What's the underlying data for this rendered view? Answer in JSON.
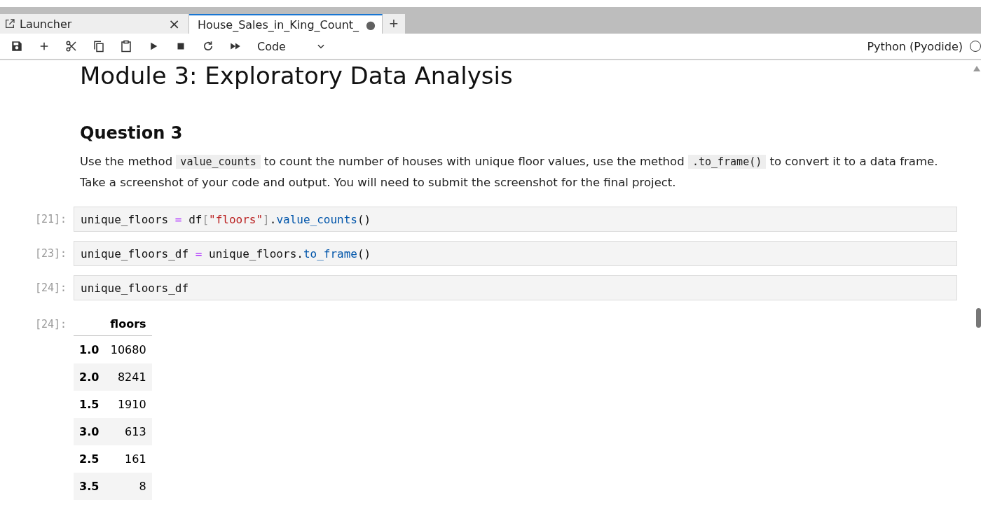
{
  "tabs": [
    {
      "label": "Launcher",
      "kind": "launcher",
      "selected": false,
      "close": "×"
    },
    {
      "label": "House_Sales_in_King_Count_",
      "kind": "notebook",
      "selected": true,
      "close": "●"
    }
  ],
  "new_tab": "+",
  "toolbar": {
    "cell_type": "Code",
    "kernel": "Python (Pyodide)",
    "kernel_busy": false
  },
  "markdown": {
    "h1": "Module 3: Exploratory Data Analysis",
    "h2": "Question 3",
    "paragraph": [
      {
        "text": "Use the method ",
        "kind": "text"
      },
      {
        "text": "value_counts",
        "kind": "code"
      },
      {
        "text": " to count the number of houses with unique floor values, use the method ",
        "kind": "text"
      },
      {
        "text": ".to_frame()",
        "kind": "code"
      },
      {
        "text": " to convert it to a data frame. Take a screenshot of your code and output. You will need to submit the screenshot for the final project.",
        "kind": "text"
      }
    ]
  },
  "cells": [
    {
      "prompt": "[21]:",
      "tokens": [
        {
          "text": "unique_floors ",
          "kind": "plain"
        },
        {
          "text": "=",
          "kind": "operator"
        },
        {
          "text": " df",
          "kind": "plain"
        },
        {
          "text": "[",
          "kind": "bracket"
        },
        {
          "text": "\"floors\"",
          "kind": "string"
        },
        {
          "text": "]",
          "kind": "bracket"
        },
        {
          "text": ".",
          "kind": "plain"
        },
        {
          "text": "value_counts",
          "kind": "method"
        },
        {
          "text": "()",
          "kind": "plain"
        }
      ]
    },
    {
      "prompt": "[23]:",
      "tokens": [
        {
          "text": "unique_floors_df ",
          "kind": "plain"
        },
        {
          "text": "=",
          "kind": "operator"
        },
        {
          "text": " unique_floors.",
          "kind": "plain"
        },
        {
          "text": "to_frame",
          "kind": "method"
        },
        {
          "text": "()",
          "kind": "plain"
        }
      ]
    },
    {
      "prompt": "[24]:",
      "tokens": [
        {
          "text": "unique_floors_df",
          "kind": "plain"
        }
      ]
    }
  ],
  "output": {
    "prompt": "[24]:",
    "columns": [
      "floors"
    ],
    "rows": [
      {
        "index": "1.0",
        "value": "10680"
      },
      {
        "index": "2.0",
        "value": "8241"
      },
      {
        "index": "1.5",
        "value": "1910"
      },
      {
        "index": "3.0",
        "value": "613"
      },
      {
        "index": "2.5",
        "value": "161"
      },
      {
        "index": "3.5",
        "value": "8"
      }
    ]
  }
}
